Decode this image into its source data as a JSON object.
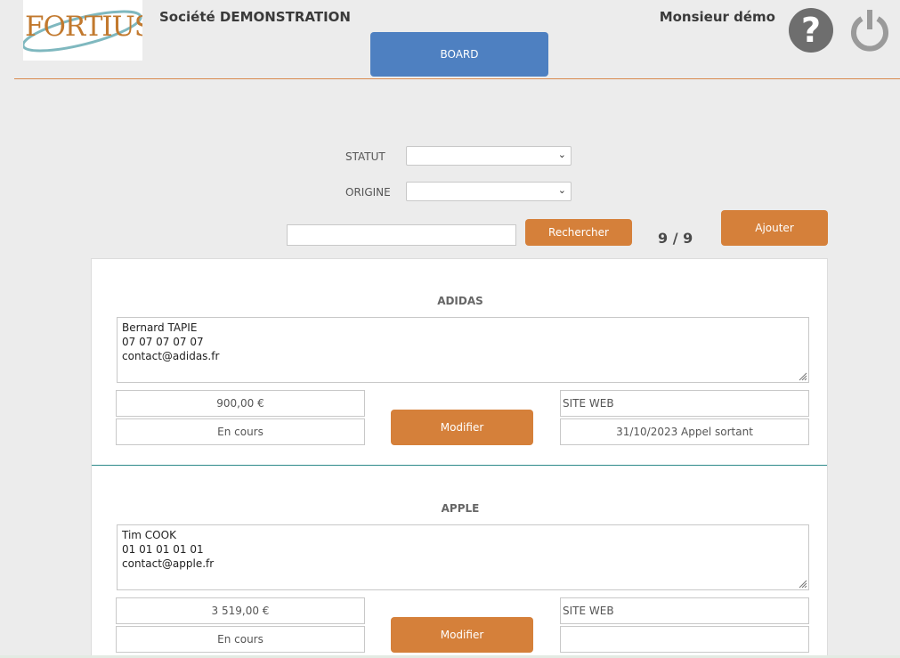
{
  "header": {
    "logo_text": "FORTIUS",
    "company": "Société DEMONSTRATION",
    "board_label": "BOARD",
    "user": "Monsieur démo",
    "help_glyph": "?"
  },
  "filters": {
    "statut_label": "STATUT",
    "statut_value": "",
    "origine_label": "ORIGINE",
    "origine_value": "",
    "search_value": "",
    "search_button": "Rechercher",
    "count": "9 / 9",
    "add_button": "Ajouter"
  },
  "cards": [
    {
      "name": "ADIDAS",
      "contact_lines": [
        "Bernard TAPIE",
        "07 07 07 07 07",
        "contact@adidas.fr"
      ],
      "amount": "900,00 €",
      "status": "En cours",
      "origin": "SITE WEB",
      "last_action": "31/10/2023 Appel sortant",
      "modify_label": "Modifier"
    },
    {
      "name": "APPLE",
      "contact_lines": [
        "Tim COOK",
        "01 01 01 01 01",
        "contact@apple.fr"
      ],
      "amount": "3 519,00 €",
      "status": "En cours",
      "origin": "SITE WEB",
      "last_action": "",
      "modify_label": "Modifier"
    }
  ],
  "colors": {
    "accent_orange": "#d5803a",
    "board_blue": "#4e80c1",
    "divider_teal": "#2e8a8a"
  },
  "icons": [
    "help-icon",
    "power-icon",
    "chevron-down-icon",
    "resize-grip-icon"
  ]
}
